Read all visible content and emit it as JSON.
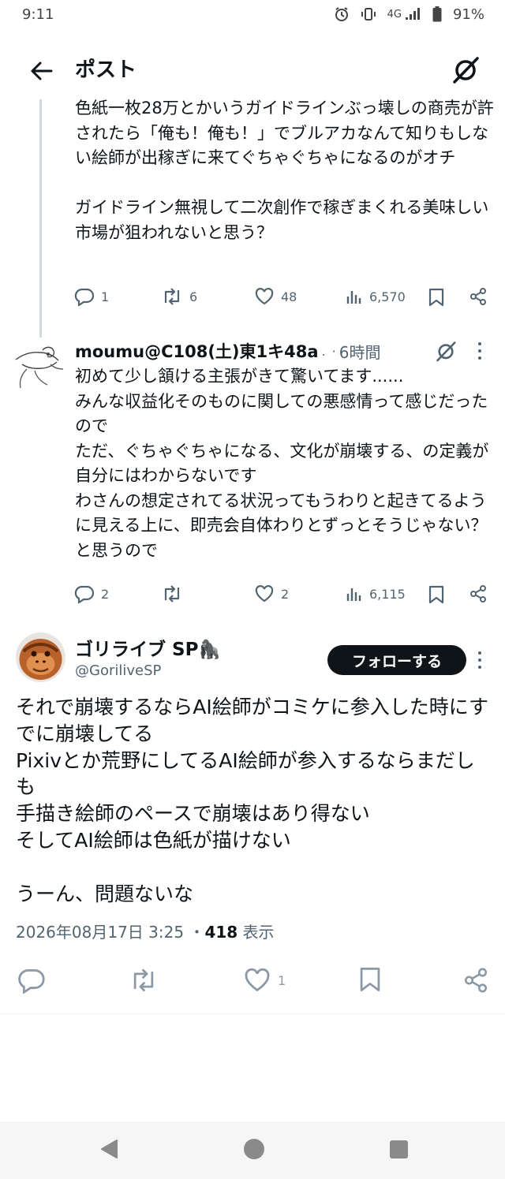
{
  "status_bar": {
    "time": "9:11",
    "network": "4G",
    "battery": "91%"
  },
  "header": {
    "title": "ポスト"
  },
  "prev_tweet": {
    "text": "色紙一枚28万とかいうガイドラインぶっ壊しの商売が許されたら「俺も！俺も！」でブルアカなんて知りもしない絵師が出稼ぎに来てぐちゃぐちゃになるのがオチ\n\nガイドライン無視して二次創作で稼ぎまくれる美味しい市場が狙われないと思う？",
    "replies": "1",
    "retweets": "6",
    "likes": "48",
    "views": "6,570"
  },
  "reply_tweet": {
    "author": "moumu@C108(土)東1キ48a",
    "separator": ".",
    "time": "6時間",
    "text": "初めて少し頷ける主張がきて驚いてます......\nみんな収益化そのものに関しての悪感情って感じだったので\nただ、ぐちゃぐちゃになる、文化が崩壊する、の定義が自分にはわからないです\nわさんの想定されてる状況ってもうわりと起きてるように見える上に、即売会自体わりとずっとそうじゃない？と思うので",
    "replies": "2",
    "likes": "2",
    "views": "6,115"
  },
  "main_tweet": {
    "author": "ゴリライブ SP🦍",
    "handle": "@GoriliveSP",
    "follow_label": "フォローする",
    "text": "それで崩壊するならAI絵師がコミケに参入した時にすでに崩壊してる\nPixivとか荒野にしてるAI絵師が参入するならまだしも\n手描き絵師のペースで崩壊はあり得ない\nそしてAI絵師は色紙が描けない\n\nうーん、問題ないな",
    "date": "2026年08月17日 3:25",
    "dot": "・",
    "views": "418",
    "views_label": "表示",
    "likes": "1"
  }
}
